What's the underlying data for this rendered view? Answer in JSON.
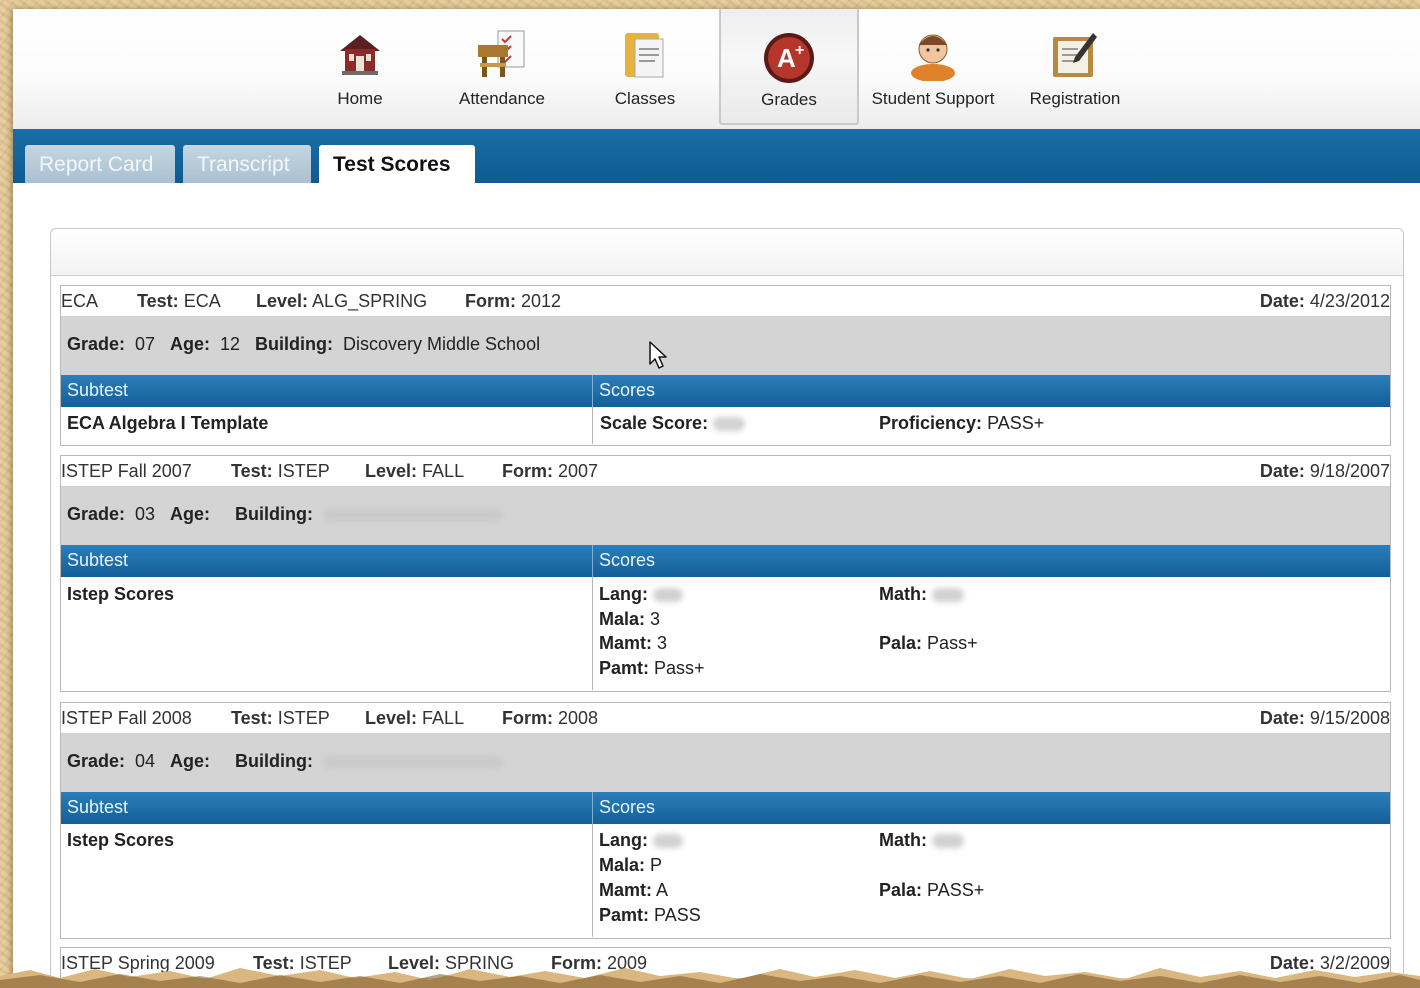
{
  "nav": {
    "items": [
      {
        "label": "Home",
        "icon": "home-icon"
      },
      {
        "label": "Attendance",
        "icon": "attendance-icon"
      },
      {
        "label": "Classes",
        "icon": "classes-icon"
      },
      {
        "label": "Grades",
        "icon": "grades-icon",
        "active": true
      },
      {
        "label": "Student Support",
        "icon": "student-support-icon"
      },
      {
        "label": "Registration",
        "icon": "registration-icon"
      }
    ]
  },
  "tabs": [
    {
      "label": "Report Card",
      "active": false
    },
    {
      "label": "Transcript",
      "active": false
    },
    {
      "label": "Test Scores",
      "active": true
    }
  ],
  "labels": {
    "test": "Test:",
    "level": "Level:",
    "form": "Form:",
    "date": "Date:",
    "grade": "Grade:",
    "age": "Age:",
    "building": "Building:",
    "subtest": "Subtest",
    "scores": "Scores"
  },
  "records": [
    {
      "name": "ECA",
      "test": "ECA",
      "level": "ALG_SPRING",
      "form": "2012",
      "date": "4/23/2012",
      "grade": "07",
      "age": "12",
      "building": "Discovery Middle School",
      "subtest": "ECA Algebra I Template",
      "scores": [
        {
          "label": "Scale Score:",
          "value": "",
          "redacted": true
        },
        {
          "label": "Proficiency:",
          "value": "PASS+"
        }
      ]
    },
    {
      "name": "ISTEP Fall 2007",
      "test": "ISTEP",
      "level": "FALL",
      "form": "2007",
      "date": "9/18/2007",
      "grade": "03",
      "age": "",
      "building": "",
      "building_redacted": true,
      "subtest": "Istep Scores",
      "scores": [
        {
          "label": "Lang:",
          "value": "",
          "redacted": true
        },
        {
          "label": "Math:",
          "value": "",
          "redacted": true
        },
        {
          "label": "Mala:",
          "value": "3"
        },
        {
          "label": "Mamt:",
          "value": "3"
        },
        {
          "label": "Pala:",
          "value": "Pass+"
        },
        {
          "label": "Pamt:",
          "value": "Pass+"
        }
      ]
    },
    {
      "name": "ISTEP Fall 2008",
      "test": "ISTEP",
      "level": "FALL",
      "form": "2008",
      "date": "9/15/2008",
      "grade": "04",
      "age": "",
      "building": "",
      "building_redacted": true,
      "subtest": "Istep Scores",
      "scores": [
        {
          "label": "Lang:",
          "value": "",
          "redacted": true
        },
        {
          "label": "Math:",
          "value": "",
          "redacted": true
        },
        {
          "label": "Mala:",
          "value": "P"
        },
        {
          "label": "Mamt:",
          "value": "A"
        },
        {
          "label": "Pala:",
          "value": "PASS+"
        },
        {
          "label": "Pamt:",
          "value": "PASS"
        }
      ]
    },
    {
      "name": "ISTEP Spring 2009",
      "test": "ISTEP",
      "level": "SPRING",
      "form": "2009",
      "date": "3/2/2009"
    }
  ]
}
